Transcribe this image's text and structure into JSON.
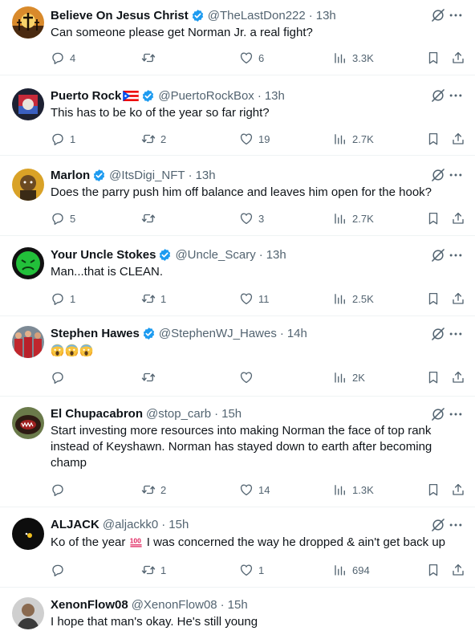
{
  "colors": {
    "text": "#0f1419",
    "muted": "#536471",
    "verified": "#1d9bf0",
    "divider": "#eff3f4"
  },
  "icons": {
    "reply": "reply-icon",
    "retweet": "retweet-icon",
    "like": "heart-icon",
    "views": "views-icon",
    "bookmark": "bookmark-icon",
    "share": "share-icon",
    "grok": "grok-icon",
    "more": "more-icon",
    "verified": "verified-badge-icon"
  },
  "tweets": [
    {
      "name": "Believe On Jesus Christ",
      "handle": "@TheLastDon222",
      "time": "13h",
      "text": "Can someone please get Norman Jr. a real fight?",
      "replies": "4",
      "retweets": "",
      "likes": "6",
      "views": "3.3K"
    },
    {
      "name": "Puerto Rock",
      "handle": "@PuertoRockBox",
      "time": "13h",
      "text": "This has to be ko of the year so far right?",
      "replies": "1",
      "retweets": "2",
      "likes": "19",
      "views": "2.7K"
    },
    {
      "name": "Marlon",
      "handle": "@ItsDigi_NFT",
      "time": "13h",
      "text": "Does the parry push him off balance and leaves him open for the hook?",
      "replies": "5",
      "retweets": "",
      "likes": "3",
      "views": "2.7K"
    },
    {
      "name": "Your Uncle Stokes",
      "handle": "@Uncle_Scary",
      "time": "13h",
      "text": "Man...that is CLEAN.",
      "replies": "1",
      "retweets": "1",
      "likes": "11",
      "views": "2.5K"
    },
    {
      "name": "Stephen Hawes",
      "handle": "@StephenWJ_Hawes",
      "time": "14h",
      "text": "",
      "replies": "",
      "retweets": "",
      "likes": "",
      "views": "2K"
    },
    {
      "name": "El Chupacabron",
      "handle": "@stop_carb",
      "time": "15h",
      "text": "Start investing more resources into making Norman the face of top rank instead of Keyshawn. Norman has stayed down to earth after becoming champ",
      "replies": "",
      "retweets": "2",
      "likes": "14",
      "views": "1.3K"
    },
    {
      "name": "ALJACK",
      "handle": "@aljackk0",
      "time": "15h",
      "text_before": "Ko of the year",
      "text_after": "I was concerned the way he dropped & ain't get back up",
      "replies": "",
      "retweets": "1",
      "likes": "1",
      "views": "694"
    },
    {
      "name": "XenonFlow08",
      "handle": "@XenonFlow08",
      "time": "15h",
      "text": "I hope that man's okay. He's still young"
    }
  ]
}
